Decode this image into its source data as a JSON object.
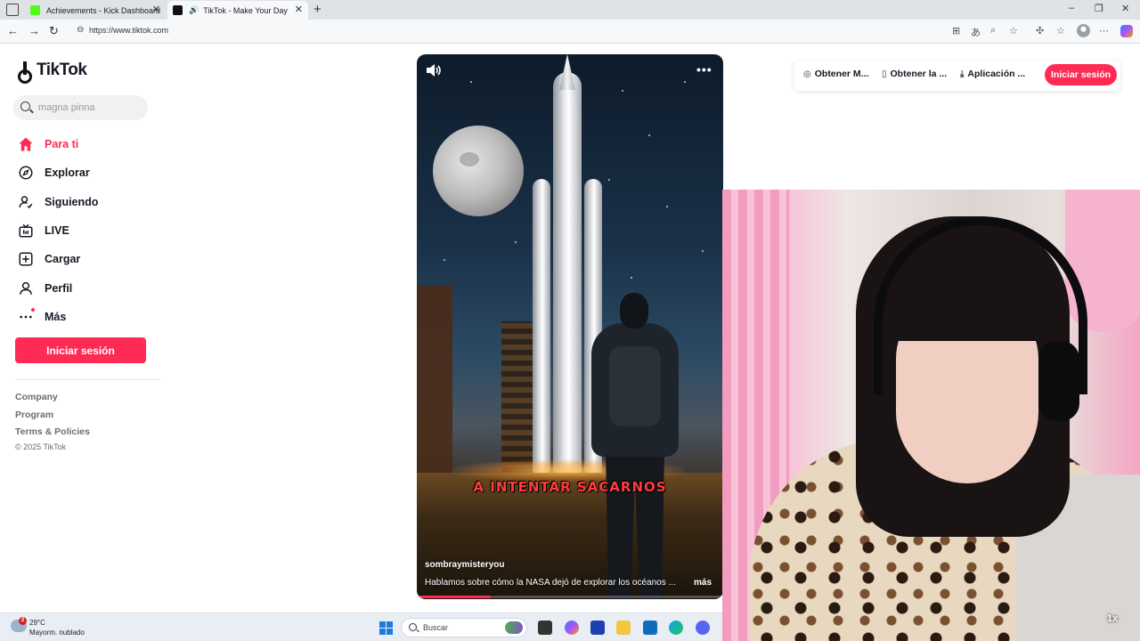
{
  "browser": {
    "tabs": [
      {
        "title": "Achievements - Kick Dashboard",
        "favicon_color": "#53fc18",
        "active": false
      },
      {
        "title": "TikTok - Make Your Day",
        "favicon_color": "#111111",
        "active": true
      }
    ],
    "new_tab_icon": "plus-icon",
    "url": "https://www.tiktok.com"
  },
  "tiktok": {
    "logo_text": "TikTok",
    "search_placeholder": "magna pinna",
    "nav": [
      {
        "label": "Para ti",
        "icon": "home-icon",
        "active": true
      },
      {
        "label": "Explorar",
        "icon": "compass-icon",
        "active": false
      },
      {
        "label": "Siguiendo",
        "icon": "following-icon",
        "active": false
      },
      {
        "label": "LIVE",
        "icon": "live-icon",
        "active": false
      },
      {
        "label": "Cargar",
        "icon": "upload-icon",
        "active": false
      },
      {
        "label": "Perfil",
        "icon": "profile-icon",
        "active": false
      },
      {
        "label": "Más",
        "icon": "more-icon",
        "active": false
      }
    ],
    "login_label": "Iniciar sesión",
    "footer": {
      "links": [
        "Company",
        "Program",
        "Terms & Policies"
      ],
      "copyright": "© 2025 TikTok"
    },
    "header": {
      "buttons": [
        {
          "label": "Obtener M...",
          "icon": "coin-icon"
        },
        {
          "label": "Obtener la ...",
          "icon": "phone-icon"
        },
        {
          "label": "Aplicación ...",
          "icon": "download-icon"
        }
      ],
      "login_label": "Iniciar sesión"
    },
    "video": {
      "caption": "A INTENTAR SACARNOS",
      "author": "sombraymisteryou",
      "description": "Hablamos sobre cómo la NASA dejó de explorar los océanos ...",
      "more_label": "más",
      "progress": 0.24
    }
  },
  "webcam": {
    "speed_label": "1x"
  },
  "taskbar": {
    "weather": {
      "temp": "29°C",
      "desc": "Mayorm. nublado",
      "badge": "2"
    },
    "search_placeholder": "Buscar",
    "apps": [
      "file-explorer-icon",
      "copilot-icon",
      "store-icon",
      "folder-icon",
      "outlook-icon",
      "edge-icon",
      "discord-icon"
    ]
  },
  "colors": {
    "accent": "#fe2c55",
    "text": "#161823"
  }
}
